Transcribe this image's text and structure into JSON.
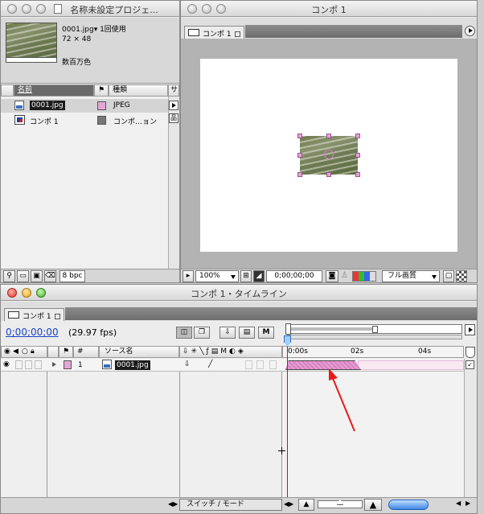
{
  "project": {
    "title": "名称未設定プロジェ...",
    "preview_name": "0001.jpg▾ 1回使用",
    "preview_dims": "72 × 48",
    "preview_colors": "数百万色",
    "col_name": "名前",
    "col_type": "種類",
    "col_size": "サ",
    "items": [
      {
        "name": "0001.jpg",
        "type": "JPEG",
        "color": "#e4a6d6"
      },
      {
        "name": "コンポ 1",
        "type": "コンポ…ョン",
        "color": "#777777"
      }
    ],
    "bpc": "8 bpc"
  },
  "comp": {
    "title": "コンポ 1",
    "tab": "コンポ 1",
    "zoom": "100%",
    "timecode": "0;00;00;00",
    "quality": "フル画質"
  },
  "timeline": {
    "title": "コンポ 1・タイムライン",
    "tab": "コンポ 1",
    "timecode": "0;00;00;00",
    "fps": "(29.97 fps)",
    "col_num": "#",
    "col_source": "ソース名",
    "layer_num": "1",
    "layer_name": "0001.jpg",
    "layer_color": "#e4a6d6",
    "ruler": [
      "0:00s",
      "02s",
      "04s"
    ],
    "switch_mode": "スイッチ / モード",
    "bar_color": "#d97fc0"
  }
}
